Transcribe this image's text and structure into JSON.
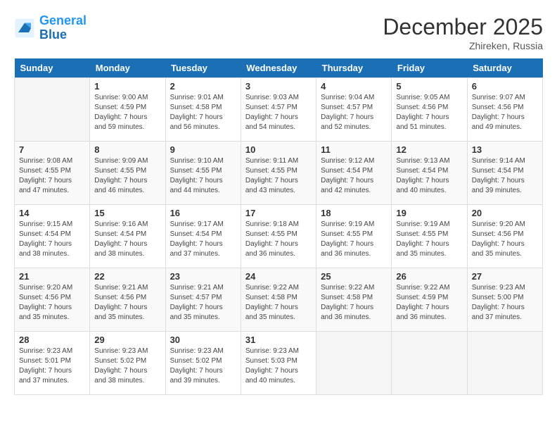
{
  "header": {
    "logo_line1": "General",
    "logo_line2": "Blue",
    "month": "December 2025",
    "location": "Zhireken, Russia"
  },
  "days_of_week": [
    "Sunday",
    "Monday",
    "Tuesday",
    "Wednesday",
    "Thursday",
    "Friday",
    "Saturday"
  ],
  "weeks": [
    [
      {
        "day": "",
        "sunrise": "",
        "sunset": "",
        "daylight": ""
      },
      {
        "day": "1",
        "sunrise": "Sunrise: 9:00 AM",
        "sunset": "Sunset: 4:59 PM",
        "daylight": "Daylight: 7 hours and 59 minutes."
      },
      {
        "day": "2",
        "sunrise": "Sunrise: 9:01 AM",
        "sunset": "Sunset: 4:58 PM",
        "daylight": "Daylight: 7 hours and 56 minutes."
      },
      {
        "day": "3",
        "sunrise": "Sunrise: 9:03 AM",
        "sunset": "Sunset: 4:57 PM",
        "daylight": "Daylight: 7 hours and 54 minutes."
      },
      {
        "day": "4",
        "sunrise": "Sunrise: 9:04 AM",
        "sunset": "Sunset: 4:57 PM",
        "daylight": "Daylight: 7 hours and 52 minutes."
      },
      {
        "day": "5",
        "sunrise": "Sunrise: 9:05 AM",
        "sunset": "Sunset: 4:56 PM",
        "daylight": "Daylight: 7 hours and 51 minutes."
      },
      {
        "day": "6",
        "sunrise": "Sunrise: 9:07 AM",
        "sunset": "Sunset: 4:56 PM",
        "daylight": "Daylight: 7 hours and 49 minutes."
      }
    ],
    [
      {
        "day": "7",
        "sunrise": "Sunrise: 9:08 AM",
        "sunset": "Sunset: 4:55 PM",
        "daylight": "Daylight: 7 hours and 47 minutes."
      },
      {
        "day": "8",
        "sunrise": "Sunrise: 9:09 AM",
        "sunset": "Sunset: 4:55 PM",
        "daylight": "Daylight: 7 hours and 46 minutes."
      },
      {
        "day": "9",
        "sunrise": "Sunrise: 9:10 AM",
        "sunset": "Sunset: 4:55 PM",
        "daylight": "Daylight: 7 hours and 44 minutes."
      },
      {
        "day": "10",
        "sunrise": "Sunrise: 9:11 AM",
        "sunset": "Sunset: 4:55 PM",
        "daylight": "Daylight: 7 hours and 43 minutes."
      },
      {
        "day": "11",
        "sunrise": "Sunrise: 9:12 AM",
        "sunset": "Sunset: 4:54 PM",
        "daylight": "Daylight: 7 hours and 42 minutes."
      },
      {
        "day": "12",
        "sunrise": "Sunrise: 9:13 AM",
        "sunset": "Sunset: 4:54 PM",
        "daylight": "Daylight: 7 hours and 40 minutes."
      },
      {
        "day": "13",
        "sunrise": "Sunrise: 9:14 AM",
        "sunset": "Sunset: 4:54 PM",
        "daylight": "Daylight: 7 hours and 39 minutes."
      }
    ],
    [
      {
        "day": "14",
        "sunrise": "Sunrise: 9:15 AM",
        "sunset": "Sunset: 4:54 PM",
        "daylight": "Daylight: 7 hours and 38 minutes."
      },
      {
        "day": "15",
        "sunrise": "Sunrise: 9:16 AM",
        "sunset": "Sunset: 4:54 PM",
        "daylight": "Daylight: 7 hours and 38 minutes."
      },
      {
        "day": "16",
        "sunrise": "Sunrise: 9:17 AM",
        "sunset": "Sunset: 4:54 PM",
        "daylight": "Daylight: 7 hours and 37 minutes."
      },
      {
        "day": "17",
        "sunrise": "Sunrise: 9:18 AM",
        "sunset": "Sunset: 4:55 PM",
        "daylight": "Daylight: 7 hours and 36 minutes."
      },
      {
        "day": "18",
        "sunrise": "Sunrise: 9:19 AM",
        "sunset": "Sunset: 4:55 PM",
        "daylight": "Daylight: 7 hours and 36 minutes."
      },
      {
        "day": "19",
        "sunrise": "Sunrise: 9:19 AM",
        "sunset": "Sunset: 4:55 PM",
        "daylight": "Daylight: 7 hours and 35 minutes."
      },
      {
        "day": "20",
        "sunrise": "Sunrise: 9:20 AM",
        "sunset": "Sunset: 4:56 PM",
        "daylight": "Daylight: 7 hours and 35 minutes."
      }
    ],
    [
      {
        "day": "21",
        "sunrise": "Sunrise: 9:20 AM",
        "sunset": "Sunset: 4:56 PM",
        "daylight": "Daylight: 7 hours and 35 minutes."
      },
      {
        "day": "22",
        "sunrise": "Sunrise: 9:21 AM",
        "sunset": "Sunset: 4:56 PM",
        "daylight": "Daylight: 7 hours and 35 minutes."
      },
      {
        "day": "23",
        "sunrise": "Sunrise: 9:21 AM",
        "sunset": "Sunset: 4:57 PM",
        "daylight": "Daylight: 7 hours and 35 minutes."
      },
      {
        "day": "24",
        "sunrise": "Sunrise: 9:22 AM",
        "sunset": "Sunset: 4:58 PM",
        "daylight": "Daylight: 7 hours and 35 minutes."
      },
      {
        "day": "25",
        "sunrise": "Sunrise: 9:22 AM",
        "sunset": "Sunset: 4:58 PM",
        "daylight": "Daylight: 7 hours and 36 minutes."
      },
      {
        "day": "26",
        "sunrise": "Sunrise: 9:22 AM",
        "sunset": "Sunset: 4:59 PM",
        "daylight": "Daylight: 7 hours and 36 minutes."
      },
      {
        "day": "27",
        "sunrise": "Sunrise: 9:23 AM",
        "sunset": "Sunset: 5:00 PM",
        "daylight": "Daylight: 7 hours and 37 minutes."
      }
    ],
    [
      {
        "day": "28",
        "sunrise": "Sunrise: 9:23 AM",
        "sunset": "Sunset: 5:01 PM",
        "daylight": "Daylight: 7 hours and 37 minutes."
      },
      {
        "day": "29",
        "sunrise": "Sunrise: 9:23 AM",
        "sunset": "Sunset: 5:02 PM",
        "daylight": "Daylight: 7 hours and 38 minutes."
      },
      {
        "day": "30",
        "sunrise": "Sunrise: 9:23 AM",
        "sunset": "Sunset: 5:02 PM",
        "daylight": "Daylight: 7 hours and 39 minutes."
      },
      {
        "day": "31",
        "sunrise": "Sunrise: 9:23 AM",
        "sunset": "Sunset: 5:03 PM",
        "daylight": "Daylight: 7 hours and 40 minutes."
      },
      {
        "day": "",
        "sunrise": "",
        "sunset": "",
        "daylight": ""
      },
      {
        "day": "",
        "sunrise": "",
        "sunset": "",
        "daylight": ""
      },
      {
        "day": "",
        "sunrise": "",
        "sunset": "",
        "daylight": ""
      }
    ]
  ]
}
